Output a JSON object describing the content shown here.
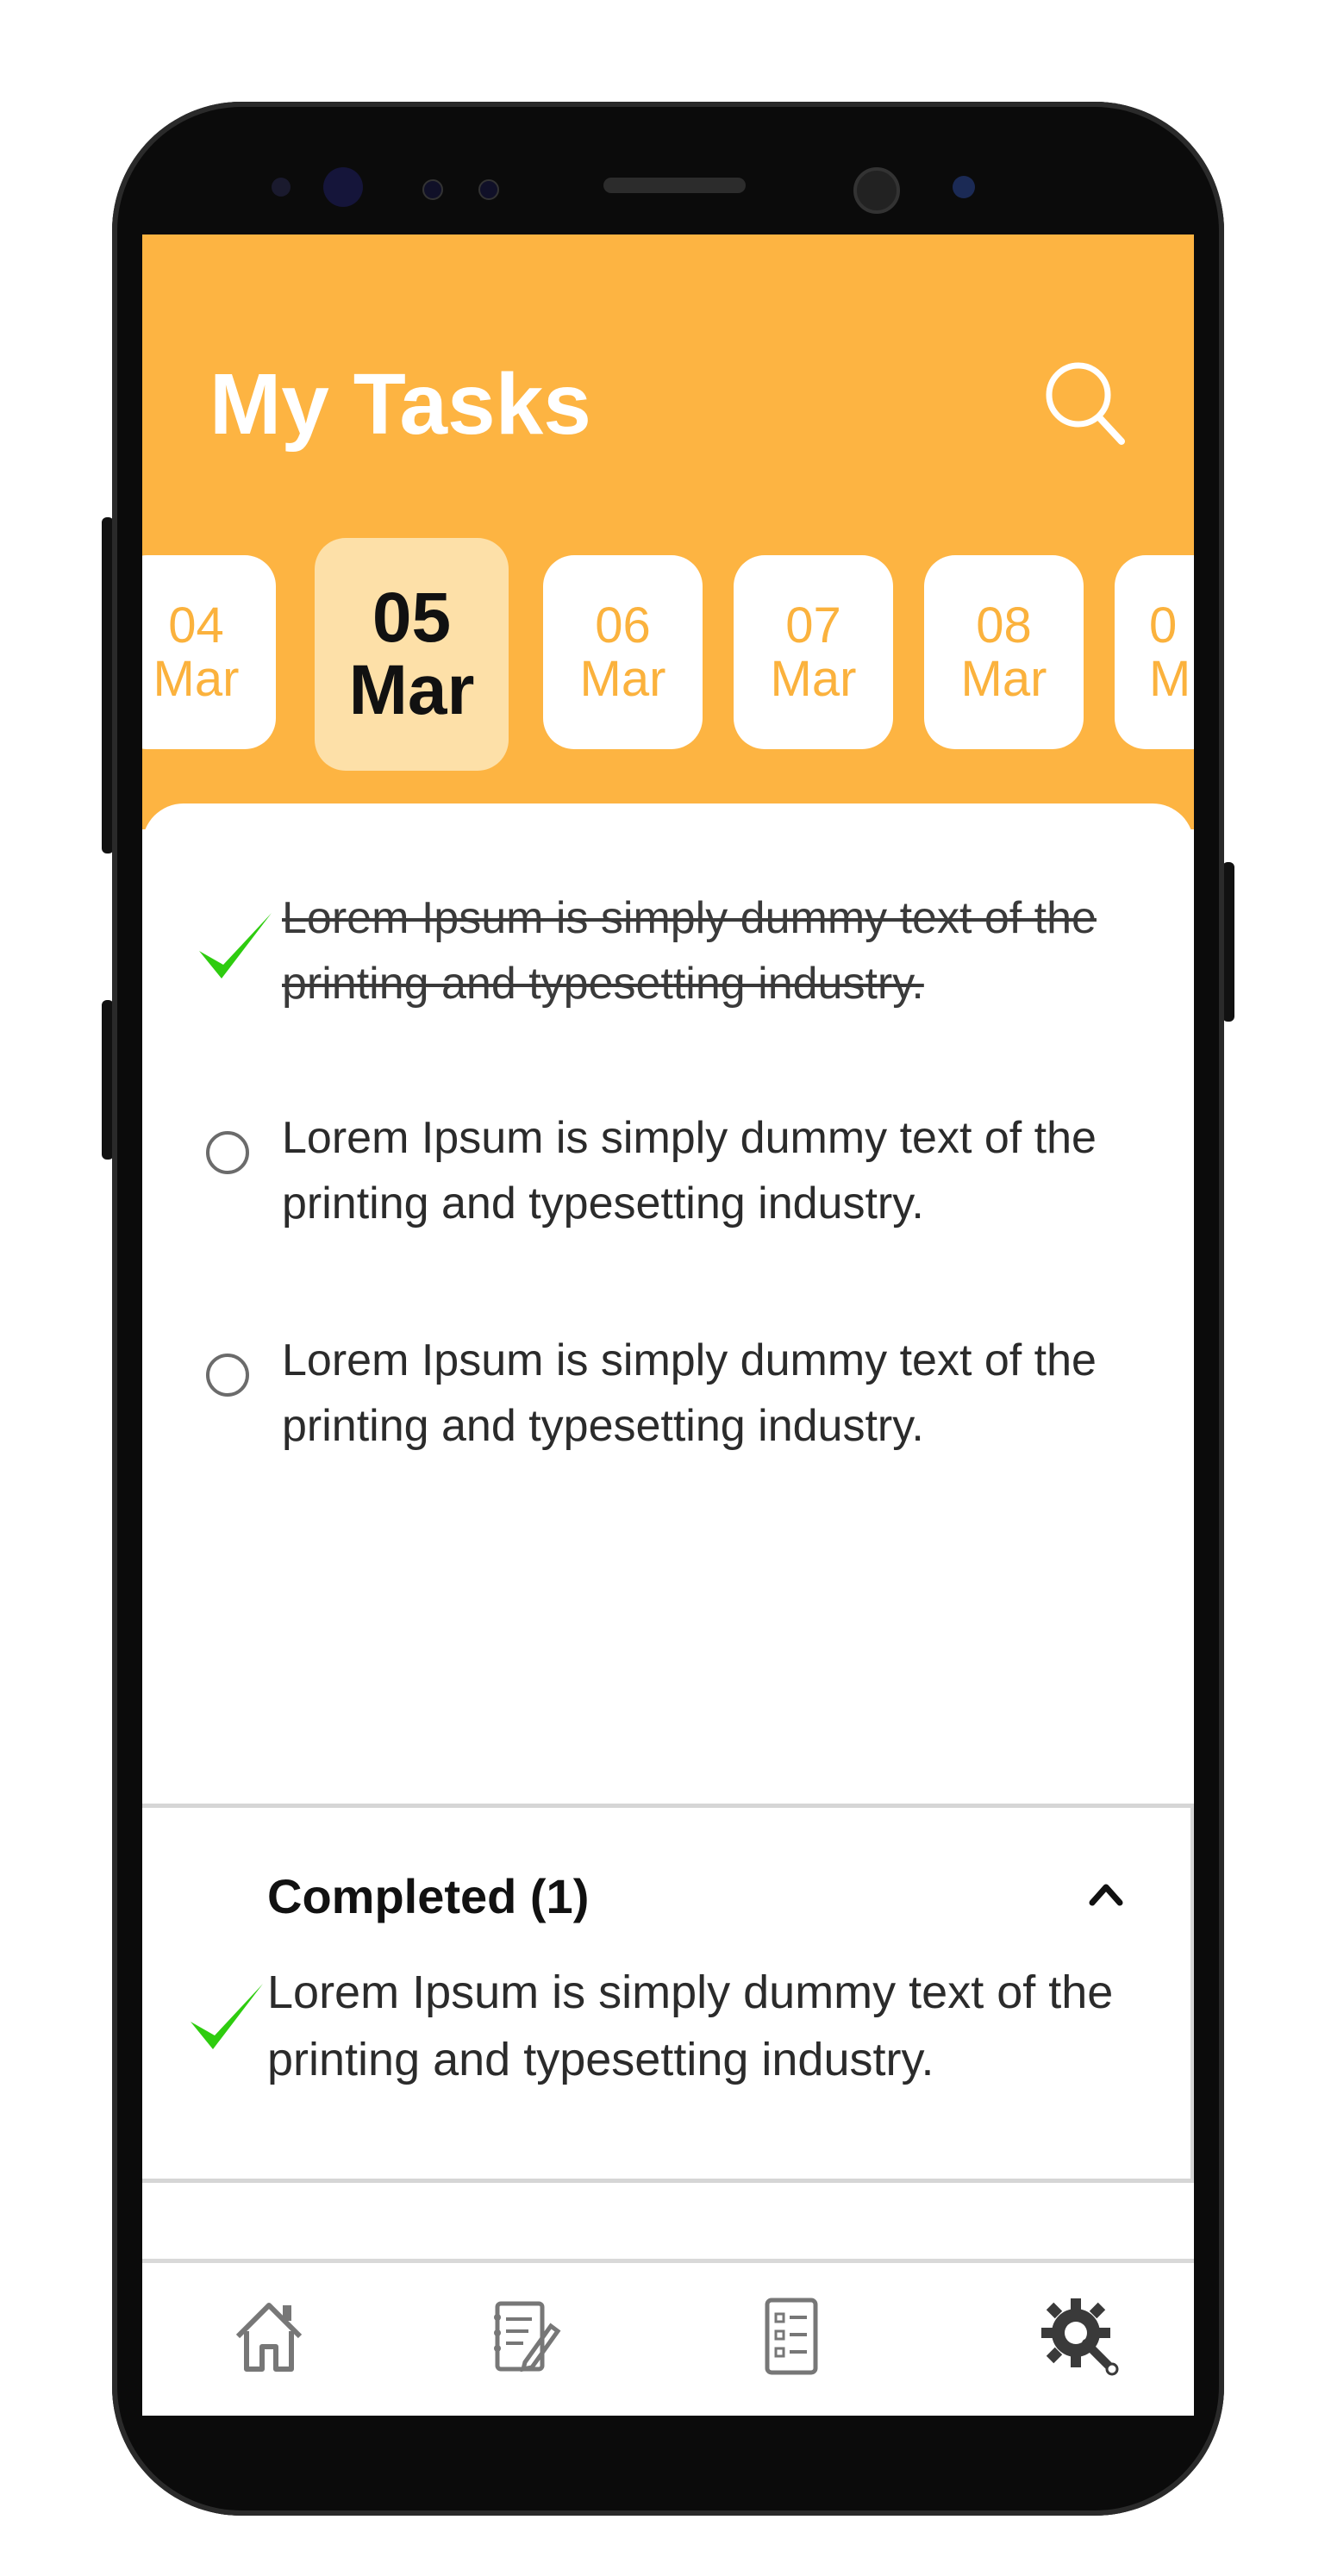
{
  "header": {
    "title": "My Tasks",
    "accent_color": "#fdb442",
    "search_icon": "search-icon"
  },
  "date_strip": {
    "items": [
      {
        "day": "04",
        "month": "Mar",
        "selected": false
      },
      {
        "day": "05",
        "month": "Mar",
        "selected": true
      },
      {
        "day": "06",
        "month": "Mar",
        "selected": false
      },
      {
        "day": "07",
        "month": "Mar",
        "selected": false
      },
      {
        "day": "08",
        "month": "Mar",
        "selected": false
      },
      {
        "day": "0",
        "month": "M",
        "selected": false
      }
    ]
  },
  "tasks": [
    {
      "text": "Lorem Ipsum is simply dummy text of the printing and typesetting industry.",
      "completed": true
    },
    {
      "text": "Lorem Ipsum is simply dummy text of the printing and typesetting industry.",
      "completed": false
    },
    {
      "text": "Lorem Ipsum is simply dummy text of the printing and typesetting industry.",
      "completed": false
    }
  ],
  "completed_section": {
    "title": "Completed (1)",
    "toggle_icon": "chevron-up-icon",
    "items": [
      {
        "text": "Lorem Ipsum is simply dummy text of the printing and typesetting industry."
      }
    ]
  },
  "bottom_nav": {
    "items": [
      {
        "icon": "home-icon"
      },
      {
        "icon": "notes-edit-icon"
      },
      {
        "icon": "checklist-icon"
      },
      {
        "icon": "settings-gear-icon"
      }
    ]
  },
  "colors": {
    "check_green": "#2ecc0f",
    "selected_date_bg": "#fde0a8"
  }
}
